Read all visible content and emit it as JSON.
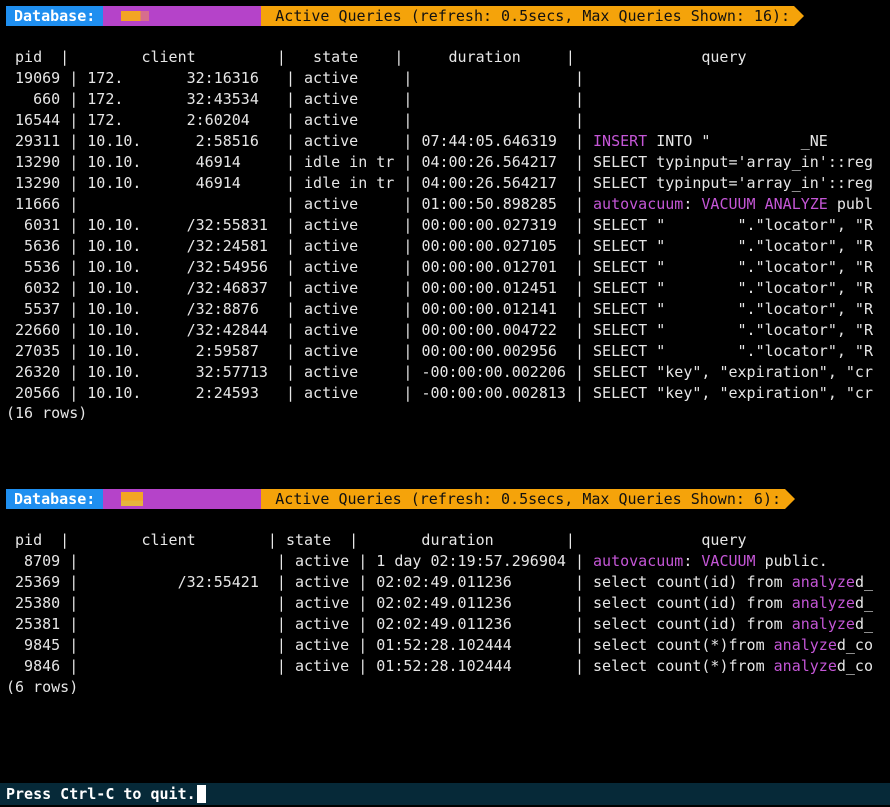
{
  "panel1": {
    "db_label": "Database:",
    "title": "Active Queries (refresh: 0.5secs, Max Queries Shown: 16):",
    "header": [
      "pid",
      "client",
      "state",
      "duration",
      "query"
    ],
    "rows": [
      {
        "pid": "19069",
        "client": "172.       32:16316",
        "state": "active",
        "duration": "",
        "query": "",
        "q_kw": ""
      },
      {
        "pid": "660",
        "client": "172.       32:43534",
        "state": "active",
        "duration": "",
        "query": "",
        "q_kw": ""
      },
      {
        "pid": "16544",
        "client": "172.       2:60204",
        "state": "active",
        "duration": "",
        "query": "",
        "q_kw": ""
      },
      {
        "pid": "29311",
        "client": "10.10.      2:58516",
        "state": "active",
        "duration": "07:44:05.646319",
        "query": "INSERT INTO \"          _NE",
        "q_kw": "INSERT"
      },
      {
        "pid": "13290",
        "client": "10.10.      46914",
        "state": "idle in tr",
        "duration": "04:00:26.564217",
        "query": "SELECT typinput='array_in'::reg",
        "q_kw": ""
      },
      {
        "pid": "13290",
        "client": "10.10.      46914",
        "state": "idle in tr",
        "duration": "04:00:26.564217",
        "query": "SELECT typinput='array_in'::reg",
        "q_kw": ""
      },
      {
        "pid": "11666",
        "client": "",
        "state": "active",
        "duration": "01:00:50.898285",
        "query": "autovacuum: VACUUM ANALYZE publ",
        "q_kw": "auto"
      },
      {
        "pid": "6031",
        "client": "10.10.     /32:55831",
        "state": "active",
        "duration": "00:00:00.027319",
        "query": "SELECT \"        \".\"locator\", \"R",
        "q_kw": ""
      },
      {
        "pid": "5636",
        "client": "10.10.     /32:24581",
        "state": "active",
        "duration": "00:00:00.027105",
        "query": "SELECT \"        \".\"locator\", \"R",
        "q_kw": ""
      },
      {
        "pid": "5536",
        "client": "10.10.     /32:54956",
        "state": "active",
        "duration": "00:00:00.012701",
        "query": "SELECT \"        \".\"locator\", \"R",
        "q_kw": ""
      },
      {
        "pid": "6032",
        "client": "10.10.     /32:46837",
        "state": "active",
        "duration": "00:00:00.012451",
        "query": "SELECT \"        \".\"locator\", \"R",
        "q_kw": ""
      },
      {
        "pid": "5537",
        "client": "10.10.     /32:8876",
        "state": "active",
        "duration": "00:00:00.012141",
        "query": "SELECT \"        \".\"locator\", \"R",
        "q_kw": ""
      },
      {
        "pid": "22660",
        "client": "10.10.     /32:42844",
        "state": "active",
        "duration": "00:00:00.004722",
        "query": "SELECT \"        \".\"locator\", \"R",
        "q_kw": ""
      },
      {
        "pid": "27035",
        "client": "10.10.      2:59587",
        "state": "active",
        "duration": "00:00:00.002956",
        "query": "SELECT \"        \".\"locator\", \"R",
        "q_kw": ""
      },
      {
        "pid": "26320",
        "client": "10.10.      32:57713",
        "state": "active",
        "duration": "-00:00:00.002206",
        "query": "SELECT \"key\", \"expiration\", \"cr",
        "q_kw": ""
      },
      {
        "pid": "20566",
        "client": "10.10.      2:24593",
        "state": "active",
        "duration": "-00:00:00.002813",
        "query": "SELECT \"key\", \"expiration\", \"cr",
        "q_kw": ""
      }
    ],
    "footer": "(16 rows)"
  },
  "panel2": {
    "db_label": "Database:",
    "title": "Active Queries (refresh: 0.5secs, Max Queries Shown: 6):",
    "header": [
      "pid",
      "client",
      "state",
      "duration",
      "query"
    ],
    "rows": [
      {
        "pid": "8709",
        "client": "",
        "state": "active",
        "duration": "1 day 02:19:57.296904",
        "query_a": "autovacuum:",
        "query_b": " VACUUM",
        "query_c": " public.",
        "kind": "auto"
      },
      {
        "pid": "25369",
        "client": "          /32:55421",
        "state": "active",
        "duration": "02:02:49.011236",
        "query_a": "select count(id) from ",
        "query_b": "analyze",
        "query_c": "d_",
        "kind": "sel"
      },
      {
        "pid": "25380",
        "client": "",
        "state": "active",
        "duration": "02:02:49.011236",
        "query_a": "select count(id) from ",
        "query_b": "analyze",
        "query_c": "d_",
        "kind": "sel"
      },
      {
        "pid": "25381",
        "client": "",
        "state": "active",
        "duration": "02:02:49.011236",
        "query_a": "select count(id) from ",
        "query_b": "analyze",
        "query_c": "d_",
        "kind": "sel"
      },
      {
        "pid": "9845",
        "client": "",
        "state": "active",
        "duration": "01:52:28.102444",
        "query_a": "select count(*)from ",
        "query_b": "analyze",
        "query_c": "d_co",
        "kind": "sel"
      },
      {
        "pid": "9846",
        "client": "",
        "state": "active",
        "duration": "01:52:28.102444",
        "query_a": "select count(*)from ",
        "query_b": "analyze",
        "query_c": "d_co",
        "kind": "sel"
      }
    ],
    "footer": "(6 rows)"
  },
  "status_bar": {
    "text": "Press Ctrl-C to quit."
  },
  "colors": {
    "db_blue": "#1f8ff0",
    "name_purple": "#b543c9",
    "title_orange": "#f5a30a",
    "keyword_purple": "#c456d6",
    "status_bg": "#062938"
  }
}
